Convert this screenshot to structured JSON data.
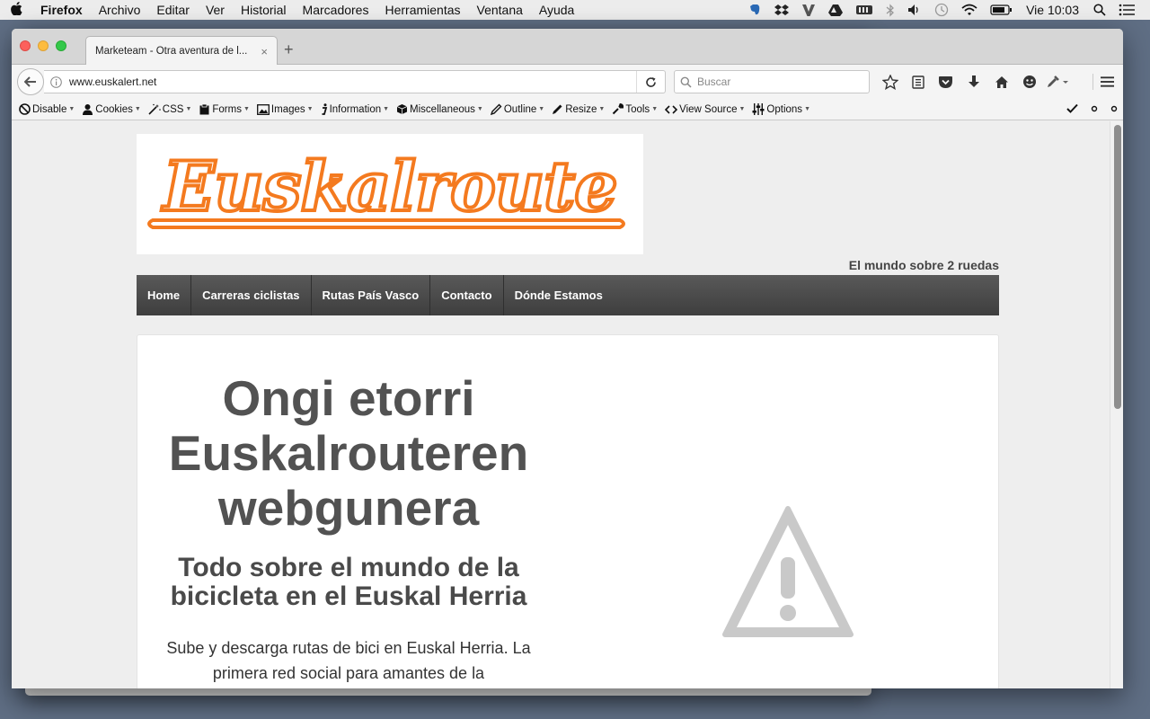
{
  "menubar": {
    "app_name": "Firefox",
    "menus": [
      "Archivo",
      "Editar",
      "Ver",
      "Historial",
      "Marcadores",
      "Herramientas",
      "Ventana",
      "Ayuda"
    ],
    "clock": "Vie 10:03"
  },
  "tab": {
    "title": "Marketeam - Otra aventura de l...",
    "close": "×"
  },
  "newtab": "+",
  "navbar": {
    "url": "www.euskalert.net",
    "search_placeholder": "Buscar"
  },
  "devbar": {
    "items": [
      "Disable",
      "Cookies",
      "CSS",
      "Forms",
      "Images",
      "Information",
      "Miscellaneous",
      "Outline",
      "Resize",
      "Tools",
      "View Source",
      "Options"
    ]
  },
  "page": {
    "logo_text": "Euskalroute",
    "tagline": "El mundo sobre 2 ruedas",
    "nav": [
      "Home",
      "Carreras ciclistas",
      "Rutas País Vasco",
      "Contacto",
      "Dónde Estamos"
    ],
    "heading": "Ongi etorri Euskalrouteren webgunera",
    "subheading": "Todo sobre el mundo de la bicicleta en el Euskal Herria",
    "body": "Sube y descarga rutas de bici en Euskal Herria. La primera red social para amantes de la"
  },
  "colors": {
    "logo_orange": "#f47a1f",
    "nav_bg": "#4a4a4a"
  }
}
